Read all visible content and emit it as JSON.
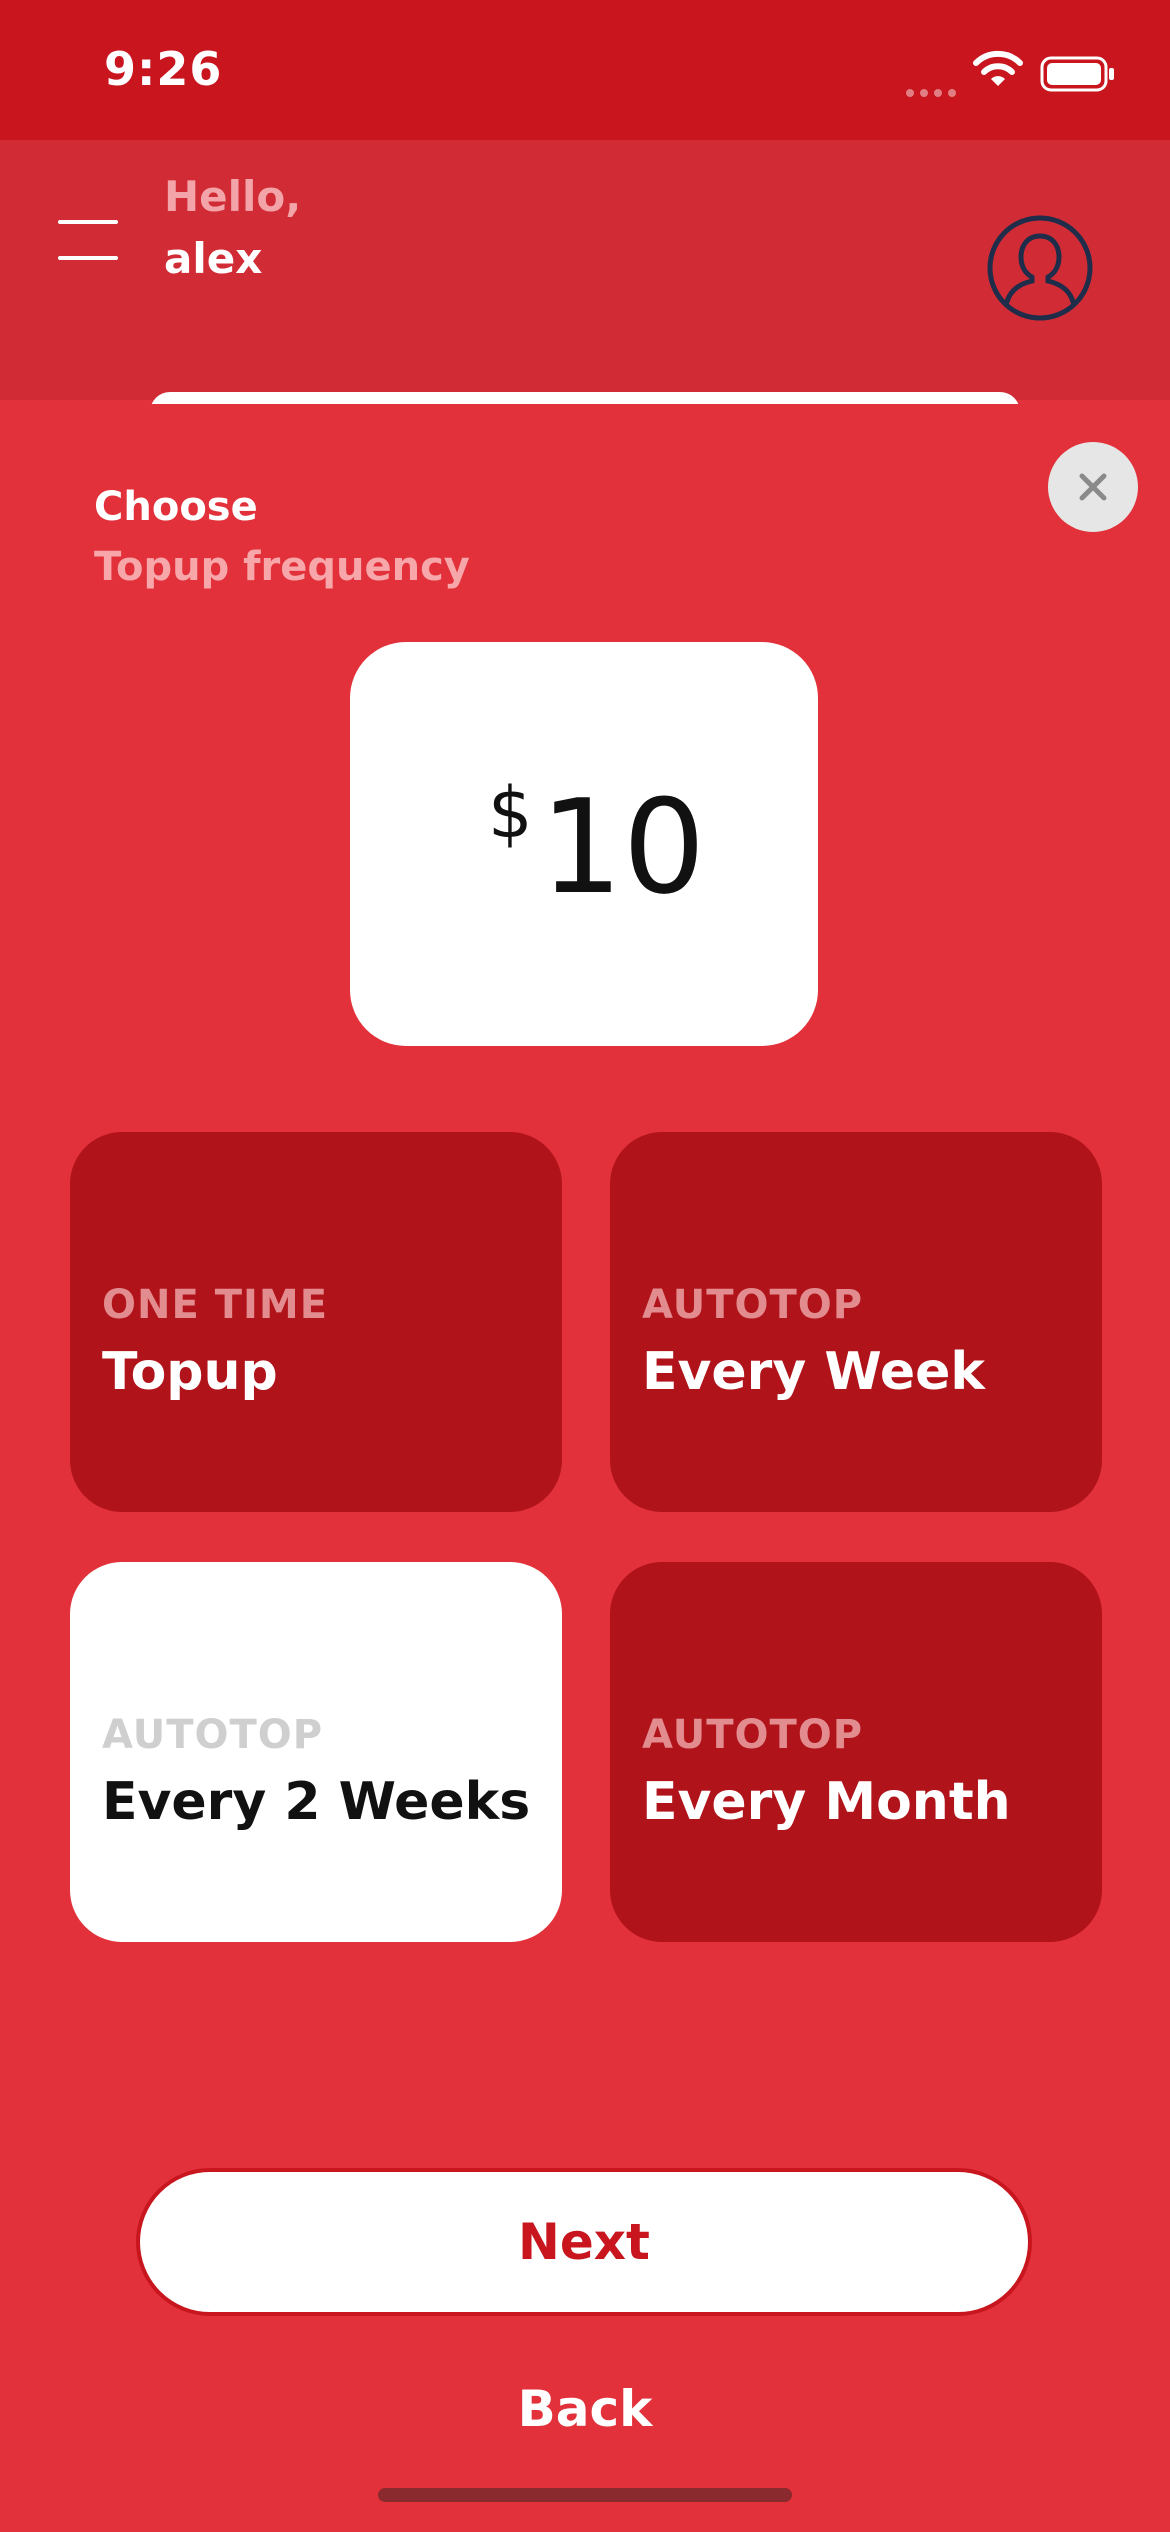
{
  "status_bar": {
    "time": "9:26"
  },
  "header": {
    "greeting": "Hello,",
    "username": "alex"
  },
  "sheet": {
    "title": "Choose",
    "subtitle": "Topup frequency",
    "amount": {
      "currency": "$",
      "value": "10"
    },
    "options": [
      {
        "kicker": "ONE TIME",
        "label": "Topup",
        "selected": false
      },
      {
        "kicker": "AUTOTOP",
        "label": "Every Week",
        "selected": false
      },
      {
        "kicker": "AUTOTOP",
        "label": "Every 2 Weeks",
        "selected": true
      },
      {
        "kicker": "AUTOTOP",
        "label": "Every Month",
        "selected": false
      }
    ],
    "next_label": "Next",
    "back_label": "Back"
  },
  "colors": {
    "primary_red": "#e2313a",
    "status_red": "#c8151e",
    "option_dark_red": "#b01319",
    "selected_option": "#ffffff"
  },
  "icons": {
    "menu": "menu-icon",
    "profile": "avatar-icon",
    "close": "close-icon",
    "wifi": "wifi-icon",
    "battery": "battery-icon"
  }
}
